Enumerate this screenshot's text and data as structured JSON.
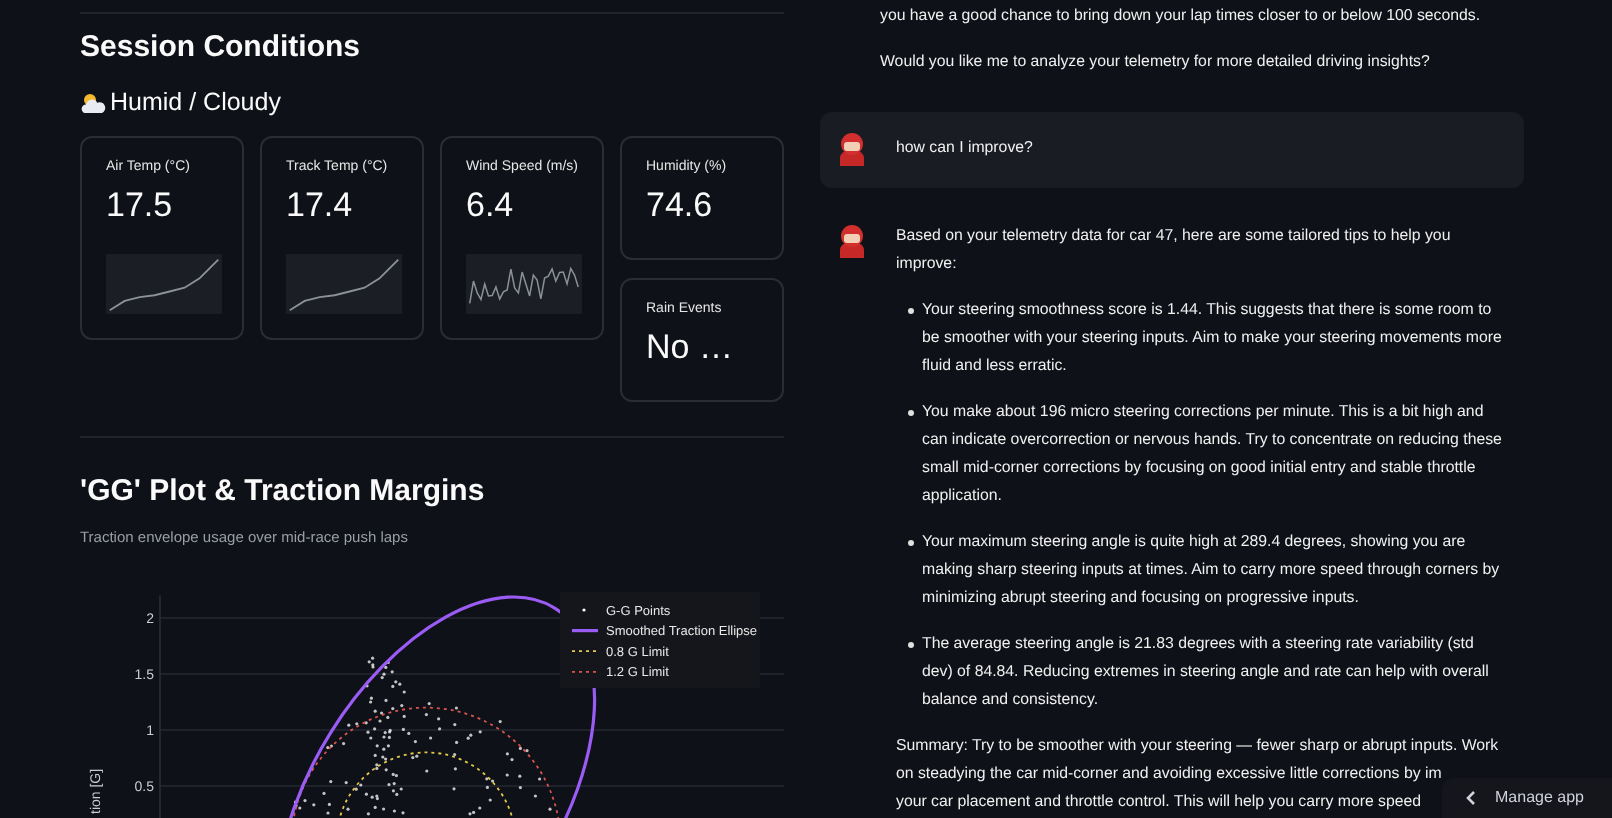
{
  "conditions": {
    "title": "Session Conditions",
    "weather": "Humid / Cloudy",
    "metrics": [
      {
        "label": "Air Temp (°C)",
        "value": "17.5",
        "kind": "trend"
      },
      {
        "label": "Track Temp (°C)",
        "value": "17.4",
        "kind": "trend"
      },
      {
        "label": "Wind Speed (m/s)",
        "value": "6.4",
        "kind": "noise"
      },
      {
        "label": "Humidity (%)",
        "value": "74.6",
        "kind": "plain"
      },
      {
        "label": "Rain Events",
        "value": "No …",
        "kind": "plain"
      }
    ]
  },
  "traction": {
    "title": "'GG' Plot & Traction Margins",
    "subtitle": "Traction envelope usage over mid-race push laps",
    "chart_data": {
      "type": "scatter",
      "ylabel": "tion [G]",
      "grid": true,
      "ylim": [
        0.14,
        2.2
      ],
      "yticks": [
        0.5,
        1,
        1.5,
        2
      ],
      "series": [
        {
          "name": "G-G Points",
          "color": "#ffffff"
        },
        {
          "name": "Smoothed Traction Ellipse",
          "color": "#9b5cf6"
        },
        {
          "name": "0.8 G Limit",
          "color": "#e6c84a"
        },
        {
          "name": "1.2 G Limit",
          "color": "#d9534f"
        }
      ]
    }
  },
  "chat": [
    {
      "kind": "text",
      "paragraphs": [
        "you have a good chance to bring down your lap times closer to or below 100 seconds.",
        "Would you like me to analyze your telemetry for more detailed driving insights?"
      ]
    },
    {
      "kind": "user",
      "text": "how can I improve?"
    },
    {
      "kind": "assistant",
      "intro": "Based on your telemetry data for car 47, here are some tailored tips to help you improve:",
      "bullets": [
        "Your steering smoothness score is 1.44. This suggests that there is some room to be smoother with your steering inputs. Aim to make your steering movements more fluid and less erratic.",
        "You make about 196 micro steering corrections per minute. This is a bit high and can indicate overcorrection or nervous hands. Try to concentrate on reducing these small mid-corner corrections by focusing on good initial entry and stable throttle application.",
        "Your maximum steering angle is quite high at 289.4 degrees, showing you are making sharp steering inputs at times. Aim to carry more speed through corners by minimizing abrupt steering and focusing on progressive inputs.",
        "The average steering angle is 21.83 degrees with a steering rate variability (std dev) of 84.84. Reducing extremes in steering angle and rate can help with overall balance and consistency."
      ],
      "summary_lines": [
        "Summary: Try to be smoother with your steering — fewer sharp or abrupt inputs. Work",
        "on steadying the car mid-corner and avoiding excessive little corrections by im",
        "your car placement and throttle control. This will help you carry more speed"
      ]
    }
  ],
  "manage_app": {
    "label": "Manage app"
  }
}
